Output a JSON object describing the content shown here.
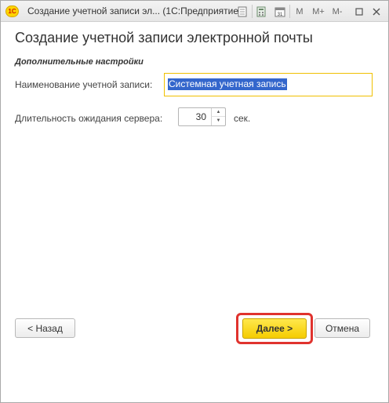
{
  "window": {
    "app_icon": "1c-logo-icon",
    "title": "Создание учетной записи эл...   (1С:Предприятие)",
    "toolbar": {
      "m_label": "M",
      "m_plus_label": "M+",
      "m_minus_label": "M-"
    }
  },
  "page": {
    "title": "Создание учетной записи электронной почты",
    "group_header": "Дополнительные настройки"
  },
  "form": {
    "account_name_label": "Наименование учетной записи:",
    "account_name_value": "Системная учетная запись",
    "timeout_label": "Длительность ожидания сервера:",
    "timeout_value": "30",
    "timeout_unit": "сек."
  },
  "buttons": {
    "back": "< Назад",
    "next": "Далее >",
    "cancel": "Отмена"
  },
  "colors": {
    "accent_yellow": "#f5cc00",
    "highlight_red": "#e0332e",
    "selection_blue": "#3366cc",
    "focus_border": "#f0c000"
  }
}
